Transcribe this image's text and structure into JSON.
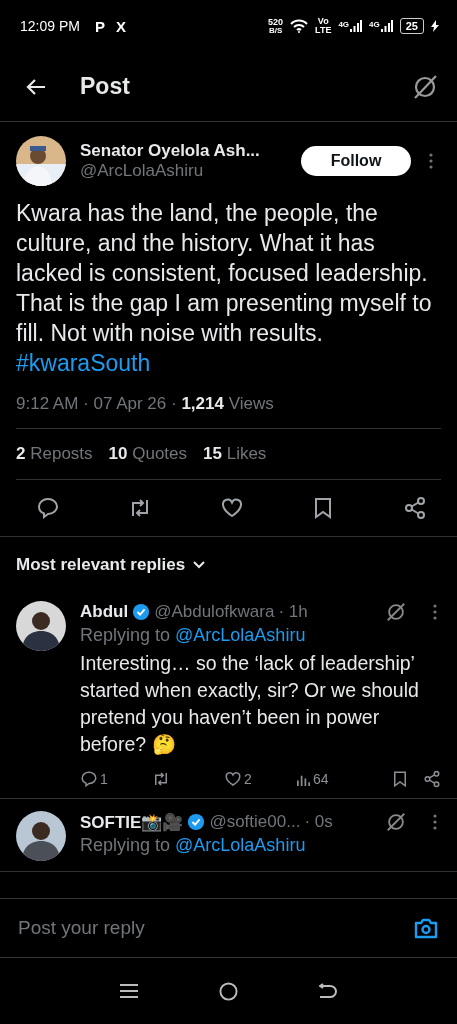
{
  "status_bar": {
    "time": "12:09 PM",
    "app_icons": [
      "P",
      "X"
    ],
    "net_speed": "520",
    "net_unit": "B/S",
    "volte_top": "Vo",
    "volte_bottom": "LTE",
    "signals": [
      "4G",
      "4G"
    ],
    "battery": "25",
    "charging": true
  },
  "header": {
    "title": "Post"
  },
  "post": {
    "author": "Senator Oyelola Ash...",
    "handle": "@ArcLolaAshiru",
    "follow_label": "Follow",
    "text": "Kwara has the land, the people, the culture, and the history. What it has lacked is consistent, focused leadership. That is the gap I am presenting myself to fill. Not with noise with results.",
    "hashtag": "#kwaraSouth",
    "meta": "9:12 AM · 07 Apr 26 · **1,214** Views",
    "stats": [
      {
        "count": "2",
        "label": "Reposts"
      },
      {
        "count": "10",
        "label": "Quotes"
      },
      {
        "count": "15",
        "label": "Likes"
      }
    ]
  },
  "replies_header": "Most relevant replies",
  "replies": [
    {
      "name": "Abdul",
      "verified": true,
      "handle": "@Abdulofkwara",
      "time": "· 1h",
      "replying_label": "Replying to",
      "replying_handle": "@ArcLolaAshiru",
      "text": "Interesting… so the ‘lack of leadership’ started when exactly, sir? Or we should pretend you haven’t been in power before? 🤔",
      "counts": {
        "replies": "1",
        "likes": "2",
        "views": "64"
      }
    },
    {
      "name": "SOFTIE📸🎥",
      "verified": true,
      "handle": "@softie00...",
      "time": "· 0s",
      "replying_label": "Replying to",
      "replying_handle": "@ArcLolaAshiru"
    }
  ],
  "composer": {
    "placeholder": "Post your reply"
  }
}
